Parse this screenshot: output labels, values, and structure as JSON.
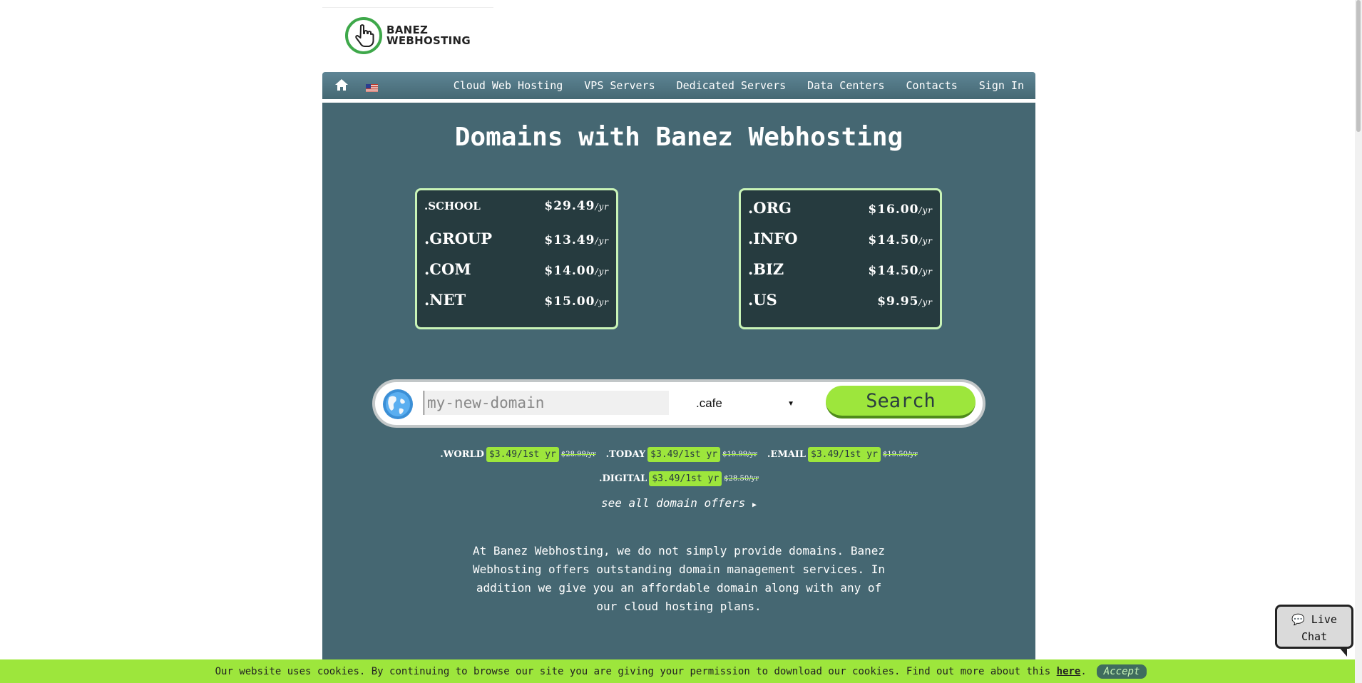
{
  "logo": {
    "line1": "BANEZ",
    "line2": "WEBHOSTING",
    "icon": "pointer-hand-icon"
  },
  "nav": {
    "home_icon": "home-icon",
    "flag_icon": "us-flag-icon",
    "links": [
      "Cloud Web Hosting",
      "VPS Servers",
      "Dedicated Servers",
      "Data Centers",
      "Contacts",
      "Sign In"
    ]
  },
  "title": "Domains with Banez Webhosting",
  "price_boxes": [
    {
      "rows": [
        {
          "tld": ".SCHOOL",
          "price": "$29.49",
          "per": "/yr"
        },
        {
          "tld": ".GROUP",
          "price": "$13.49",
          "per": "/yr"
        },
        {
          "tld": ".COM",
          "price": "$14.00",
          "per": "/yr"
        },
        {
          "tld": ".NET",
          "price": "$15.00",
          "per": "/yr"
        }
      ]
    },
    {
      "rows": [
        {
          "tld": ".ORG",
          "price": "$16.00",
          "per": "/yr"
        },
        {
          "tld": ".INFO",
          "price": "$14.50",
          "per": "/yr"
        },
        {
          "tld": ".BIZ",
          "price": "$14.50",
          "per": "/yr"
        },
        {
          "tld": ".US",
          "price": "$9.95",
          "per": "/yr"
        }
      ]
    }
  ],
  "search": {
    "placeholder": "my-new-domain",
    "selected_tld": ".cafe",
    "button": "Search",
    "globe_icon": "globe-icon"
  },
  "offers": [
    {
      "tld": ".WORLD",
      "deal": "$3.49/1st yr",
      "old": "$28.99/yr"
    },
    {
      "tld": ".TODAY",
      "deal": "$3.49/1st yr",
      "old": "$19.99/yr"
    },
    {
      "tld": ".EMAIL",
      "deal": "$3.49/1st yr",
      "old": "$19.50/yr"
    },
    {
      "tld": ".DIGITAL",
      "deal": "$3.49/1st yr",
      "old": "$28.50/yr"
    }
  ],
  "see_all": "see all domain offers",
  "description": "At Banez Webhosting, we do not simply provide domains. Banez Webhosting offers outstanding domain management services. In addition we give you an affordable domain along with any of our cloud hosting plans.",
  "live_chat": {
    "line1": "Live",
    "line2": "Chat",
    "icon": "chat-bubble-icon"
  },
  "cookie": {
    "text": "Our website uses cookies. By continuing to browse our site you are giving your permission to download our cookies. Find out more about this",
    "link": "here",
    "period": ".",
    "accept": "Accept"
  },
  "colors": {
    "panel": "#456772",
    "accent_green": "#9de63c",
    "box_bg": "#263b3f",
    "box_border": "#c9f4b7",
    "logo_green": "#3ea84a"
  }
}
